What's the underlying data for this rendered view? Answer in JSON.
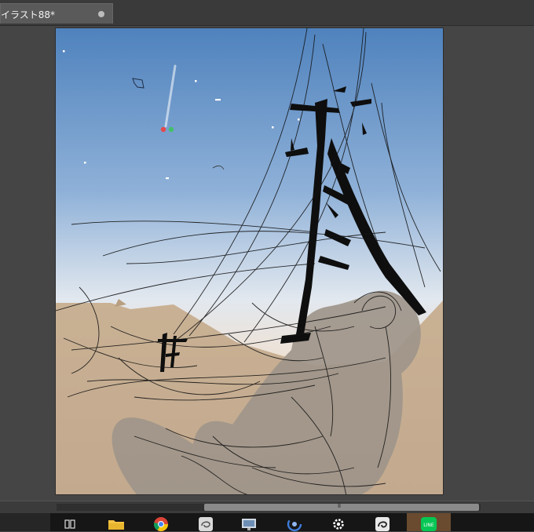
{
  "document_tab": {
    "title": "イラスト88*"
  },
  "canvas": {
    "description_id": "illustration-canvas"
  },
  "scrollbar": {
    "grip": "⦀"
  },
  "taskbar": {
    "icons": [
      "task-view-icon",
      "folder-icon",
      "chrome-icon",
      "clip-studio-icon",
      "monitor-icon",
      "loading-icon",
      "gear-icon",
      "clip-studio-paint-icon",
      "line-icon"
    ],
    "line_label": "LINE"
  },
  "colors": {
    "sky_top": "#4f82bd",
    "sky_bottom": "#f2dcc8",
    "desert": "#c8ad90",
    "sketch": "#141414"
  }
}
